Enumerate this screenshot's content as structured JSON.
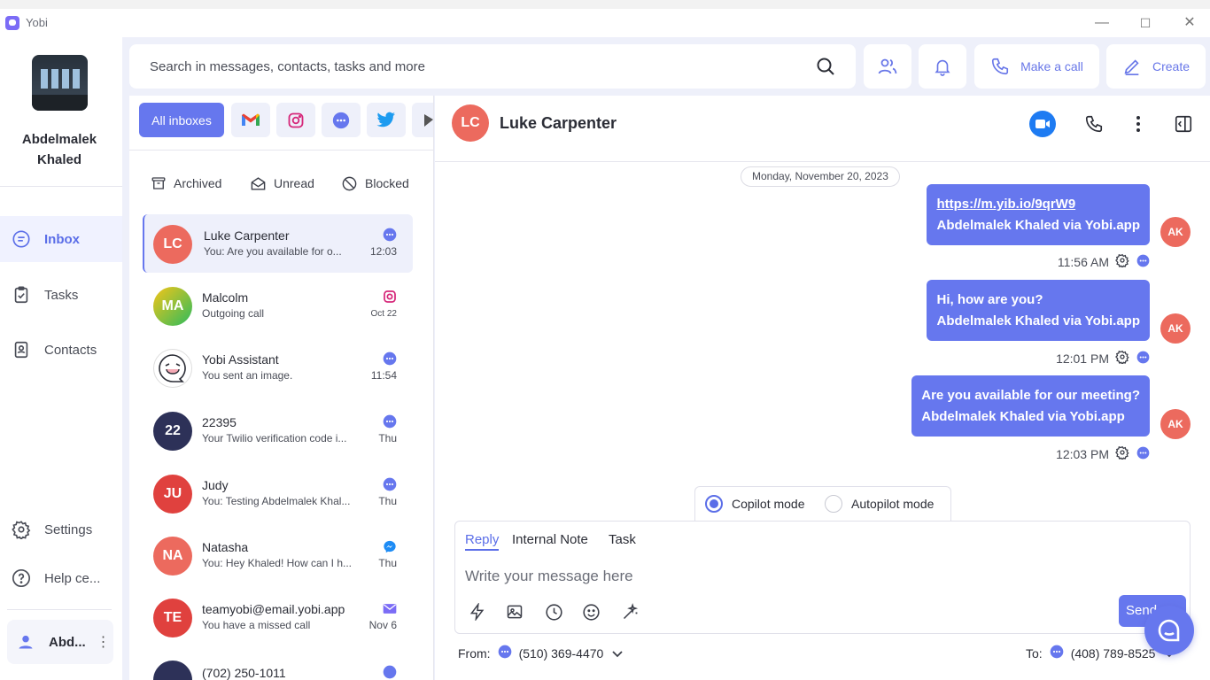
{
  "window": {
    "title": "Yobi",
    "controls": {
      "minimize": "—",
      "maximize": "☐",
      "close": "✕"
    }
  },
  "sidebar": {
    "user_name": "Abdelmalek Khaled",
    "items": [
      {
        "label": "Inbox",
        "icon": "chat-icon",
        "active": true
      },
      {
        "label": "Tasks",
        "icon": "clipboard-check-icon"
      },
      {
        "label": "Contacts",
        "icon": "contact-book-icon"
      }
    ],
    "bottom_items": [
      {
        "label": "Settings",
        "icon": "gear-icon"
      },
      {
        "label": "Help ce...",
        "icon": "help-icon"
      }
    ],
    "account": {
      "name": "Abd...",
      "more": "⋮"
    }
  },
  "header": {
    "search_placeholder": "Search in messages, contacts, tasks and more",
    "make_call_label": "Make a call",
    "create_label": "Create"
  },
  "inbox": {
    "all_inboxes_label": "All inboxes",
    "channel_filters": [
      "gmail",
      "instagram",
      "yobi-chat",
      "twitter"
    ],
    "filters": [
      {
        "label": "Archived",
        "icon": "archive-icon"
      },
      {
        "label": "Unread",
        "icon": "envelope-open-icon"
      },
      {
        "label": "Blocked",
        "icon": "blocked-icon"
      }
    ],
    "conversations": [
      {
        "initials": "LC",
        "name": "Luke Carpenter",
        "preview": "You: Are you available for o...",
        "time": "12:03",
        "channel": "chat",
        "color": "#ec6a5e",
        "selected": true
      },
      {
        "initials": "MA",
        "name": "Malcolm",
        "preview": "Outgoing call",
        "time": "Oct 22",
        "channel": "instagram",
        "color": "#41c06a"
      },
      {
        "initials": "",
        "name": "Yobi Assistant",
        "preview": "You sent an image.",
        "time": "11:54",
        "channel": "chat",
        "color": "#ffffff"
      },
      {
        "initials": "22",
        "name": "22395",
        "preview": "Your Twilio verification code i...",
        "time": "Thu",
        "channel": "chat",
        "color": "#2d3158"
      },
      {
        "initials": "JU",
        "name": "Judy",
        "preview": "You: Testing Abdelmalek Khal...",
        "time": "Thu",
        "channel": "chat",
        "color": "#e0413e"
      },
      {
        "initials": "NA",
        "name": "Natasha",
        "preview": "You: Hey Khaled! How can I h...",
        "time": "Thu",
        "channel": "messenger",
        "color": "#ec6a5e"
      },
      {
        "initials": "TE",
        "name": "teamyobi@email.yobi.app",
        "preview": "You have a missed call",
        "time": "Nov 6",
        "channel": "email",
        "color": "#e0413e"
      },
      {
        "initials": "",
        "name": "(702) 250-1011",
        "preview": "",
        "time": "",
        "channel": "chat",
        "color": "#2d3158"
      }
    ]
  },
  "chat": {
    "contact_initials": "LC",
    "contact_name": "Luke Carpenter",
    "date_label": "Monday, November 20, 2023",
    "messages": [
      {
        "line1": "https://m.yib.io/9qrW9",
        "line2": "Abdelmalek Khaled via Yobi.app",
        "time": "11:56 AM",
        "sender_initials": "AK",
        "is_link": true
      },
      {
        "line1": "Hi, how are you?",
        "line2": "Abdelmalek Khaled via Yobi.app",
        "time": "12:01 PM",
        "sender_initials": "AK"
      },
      {
        "line1": "Are you available for our meeting?",
        "line2": "Abdelmalek Khaled via Yobi.app",
        "time": "12:03 PM",
        "sender_initials": "AK"
      }
    ],
    "modes": {
      "copilot": "Copilot mode",
      "autopilot": "Autopilot mode",
      "selected": "copilot"
    },
    "composer": {
      "tabs": [
        "Reply",
        "Internal Note",
        "Task"
      ],
      "active_tab": "Reply",
      "placeholder": "Write your message here",
      "tools": [
        "lightning-icon",
        "image-icon",
        "clock-icon",
        "emoji-icon",
        "magic-wand-icon"
      ],
      "send_label": "Send"
    },
    "from_label": "From:",
    "from_number": "(510) 369-4470",
    "to_label": "To:",
    "to_number": "(408) 789-8525"
  },
  "colors": {
    "accent": "#6677ee",
    "avatar_red": "#ec6a5e",
    "background": "#eef0fa"
  }
}
